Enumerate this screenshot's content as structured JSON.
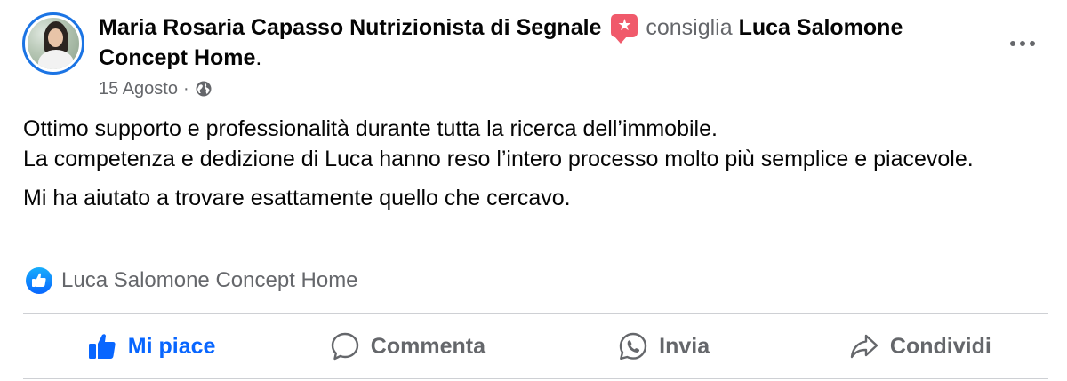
{
  "post": {
    "author_name": "Maria Rosaria Capasso Nutrizionista di Segnale",
    "recommend_verb": "consiglia",
    "page_name": "Luca Salomone Concept Home",
    "page_name_period": ".",
    "date": "15 Agosto",
    "separator": "·",
    "text_line1": "Ottimo supporto e professionalità durante tutta la ricerca dell’immobile.",
    "text_line2": "La competenza e dedizione di Luca hanno reso l’intero processo molto più semplice e piacevole.",
    "text_line3": "Mi ha aiutato a trovare esattamente quello che cercavo.",
    "reactions_label": "Luca Salomone Concept Home"
  },
  "icons": {
    "avatar": "profile-photo",
    "recommend": "recommend-star-icon",
    "privacy": "globe-icon",
    "more": "more-horizontal-icon",
    "reaction": "like-badge-icon"
  },
  "actions": {
    "like": "Mi piace",
    "comment": "Commenta",
    "send": "Invia",
    "share": "Condividi"
  },
  "colors": {
    "accent": "#0866ff",
    "avatar_ring": "#1b74e4",
    "recommend_badge": "#f05a6b",
    "muted_text": "#65676b"
  }
}
